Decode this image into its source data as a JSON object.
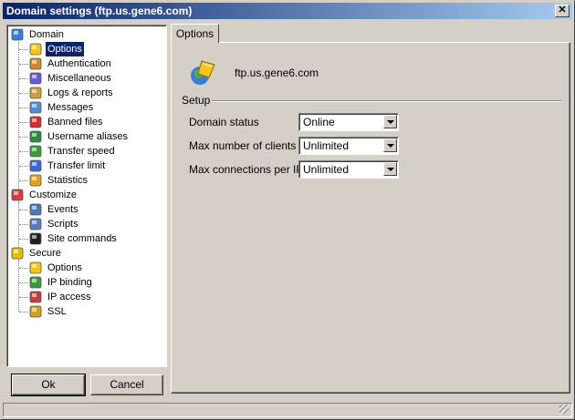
{
  "window": {
    "title": "Domain settings (ftp.us.gene6.com)"
  },
  "tree": {
    "items": [
      {
        "label": "Domain",
        "icon": "domain-icon",
        "level": 0
      },
      {
        "label": "Options",
        "icon": "options-icon",
        "level": 1,
        "selected": true
      },
      {
        "label": "Authentication",
        "icon": "authentication-icon",
        "level": 1
      },
      {
        "label": "Miscellaneous",
        "icon": "miscellaneous-icon",
        "level": 1
      },
      {
        "label": "Logs & reports",
        "icon": "logs-icon",
        "level": 1
      },
      {
        "label": "Messages",
        "icon": "messages-icon",
        "level": 1
      },
      {
        "label": "Banned files",
        "icon": "banned-files-icon",
        "level": 1
      },
      {
        "label": "Username aliases",
        "icon": "username-aliases-icon",
        "level": 1
      },
      {
        "label": "Transfer speed",
        "icon": "transfer-speed-icon",
        "level": 1
      },
      {
        "label": "Transfer limit",
        "icon": "transfer-limit-icon",
        "level": 1
      },
      {
        "label": "Statistics",
        "icon": "statistics-icon",
        "level": 1
      },
      {
        "label": "Customize",
        "icon": "customize-icon",
        "level": 0
      },
      {
        "label": "Events",
        "icon": "events-icon",
        "level": 1
      },
      {
        "label": "Scripts",
        "icon": "scripts-icon",
        "level": 1
      },
      {
        "label": "Site commands",
        "icon": "site-commands-icon",
        "level": 1
      },
      {
        "label": "Secure",
        "icon": "secure-icon",
        "level": 0
      },
      {
        "label": "Options",
        "icon": "options-icon",
        "level": 1
      },
      {
        "label": "IP binding",
        "icon": "ip-binding-icon",
        "level": 1
      },
      {
        "label": "IP access",
        "icon": "ip-access-icon",
        "level": 1
      },
      {
        "label": "SSL",
        "icon": "ssl-key-icon",
        "level": 1
      }
    ]
  },
  "buttons": {
    "ok": "Ok",
    "cancel": "Cancel"
  },
  "tabs": [
    {
      "label": "Options",
      "active": true
    }
  ],
  "panel": {
    "domain_name": "ftp.us.gene6.com",
    "group_label": "Setup",
    "fields": [
      {
        "label": "Domain status",
        "value": "Online"
      },
      {
        "label": "Max number of clients",
        "value": "Unlimited"
      },
      {
        "label": "Max connections per IP",
        "value": "Unlimited"
      }
    ]
  },
  "colors": {
    "title_start": "#0a246a",
    "title_end": "#a6caf0",
    "selection": "#0a246a",
    "face": "#d4d0c8"
  }
}
